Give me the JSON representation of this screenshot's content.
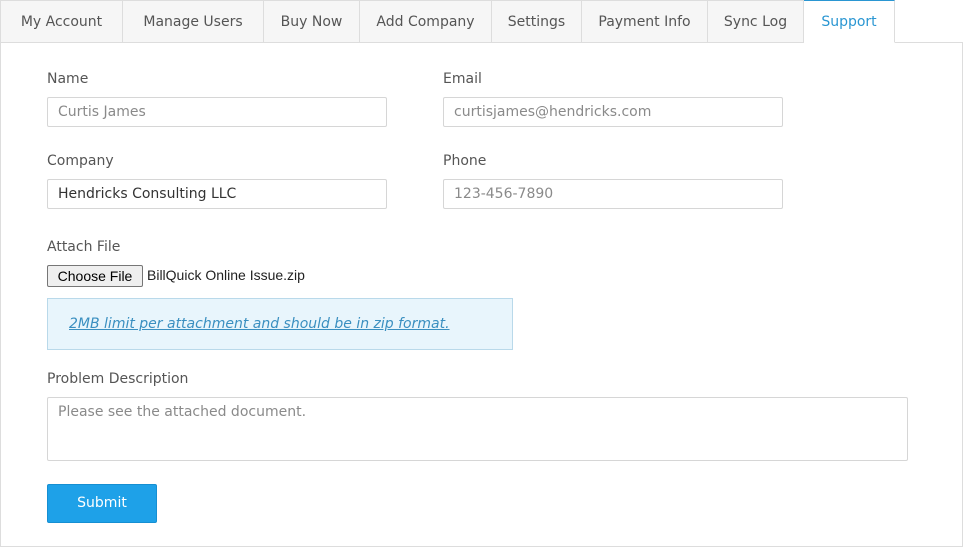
{
  "tabs": [
    {
      "label": "My Account"
    },
    {
      "label": "Manage Users"
    },
    {
      "label": "Buy Now"
    },
    {
      "label": "Add Company"
    },
    {
      "label": "Settings"
    },
    {
      "label": "Payment Info"
    },
    {
      "label": "Sync Log"
    },
    {
      "label": "Support",
      "active": true
    }
  ],
  "form": {
    "name": {
      "label": "Name",
      "placeholder": "Curtis James",
      "value": ""
    },
    "email": {
      "label": "Email",
      "placeholder": "curtisjames@hendricks.com",
      "value": ""
    },
    "company": {
      "label": "Company",
      "placeholder": "",
      "value": "Hendricks Consulting LLC"
    },
    "phone": {
      "label": "Phone",
      "placeholder": "123-456-7890",
      "value": ""
    },
    "attach": {
      "label": "Attach File",
      "button_label": "Choose File",
      "file_name": "BillQuick Online Issue.zip",
      "notice": "2MB limit per attachment and should be in zip format."
    },
    "description": {
      "label": "Problem Description",
      "placeholder": "Please see the attached document.",
      "value": ""
    },
    "submit_label": "Submit"
  },
  "colors": {
    "accent": "#2a96d2",
    "submit": "#1ea1e8",
    "notice_bg": "#e8f5fc"
  }
}
